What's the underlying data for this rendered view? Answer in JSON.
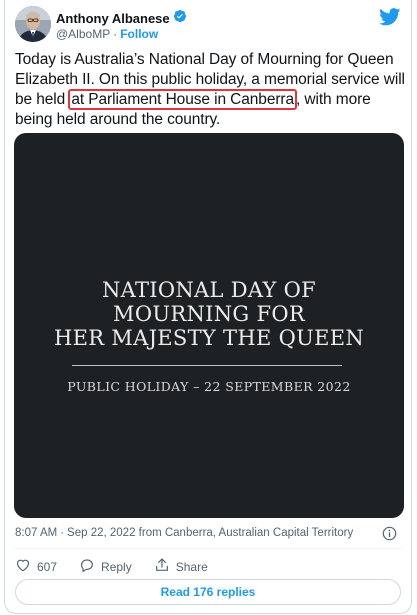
{
  "tweet": {
    "author_name": "Anthony Albanese",
    "handle": "@AlboMP",
    "separator": "·",
    "follow_label": "Follow",
    "text_before": "Today is Australia’s National Day of Mourning for Queen Elizabeth II. On this public holiday, a memorial service will be held ",
    "text_highlight": "at Parliament House in Canberra",
    "text_after": ", with more being held around the country.",
    "highlight_color": "#e0353b"
  },
  "media": {
    "heading": "NATIONAL DAY OF\nMOURNING FOR\nHER MAJESTY THE QUEEN",
    "subheading": "PUBLIC HOLIDAY – 22 SEPTEMBER 2022",
    "background": "#1e2124"
  },
  "meta": {
    "time": "8:07 AM",
    "separator": "·",
    "date_location": "Sep 22, 2022 from Canberra, Australian Capital Territory"
  },
  "actions": {
    "like_count": "607",
    "reply_label": "Reply",
    "share_label": "Share"
  },
  "replies_button": "Read 176 replies",
  "colors": {
    "brand": "#1d9bf0",
    "text": "#0f1419",
    "muted": "#536471"
  },
  "icons": [
    "verified-badge-icon",
    "twitter-bird-icon",
    "info-icon",
    "heart-icon",
    "reply-icon",
    "share-icon"
  ]
}
